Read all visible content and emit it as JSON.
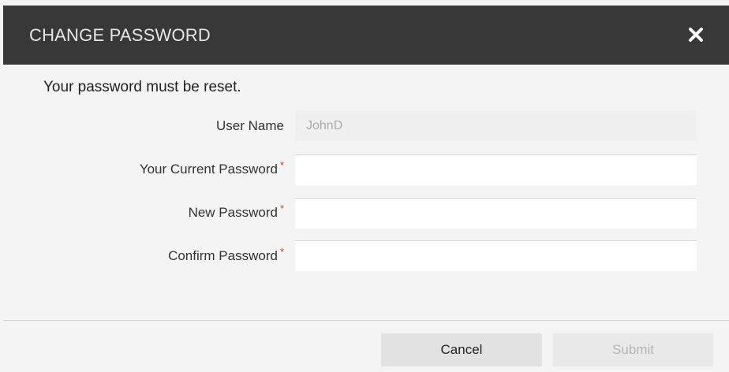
{
  "dialog": {
    "title": "CHANGE PASSWORD",
    "close_icon": "close-icon",
    "message": "Your password must be reset."
  },
  "form": {
    "username": {
      "label": "User Name",
      "value": "JohnD",
      "required": false
    },
    "current_password": {
      "label": "Your Current Password",
      "value": "",
      "required": true
    },
    "new_password": {
      "label": "New Password",
      "value": "",
      "required": true
    },
    "confirm_password": {
      "label": "Confirm Password",
      "value": "",
      "required": true
    },
    "required_marker": "*"
  },
  "footer": {
    "cancel_label": "Cancel",
    "submit_label": "Submit",
    "submit_disabled": true
  },
  "colors": {
    "header_bg": "#383838",
    "header_text": "#e6e6e6",
    "required_marker": "#e03b2a",
    "dialog_bg": "#f4f4f4"
  }
}
